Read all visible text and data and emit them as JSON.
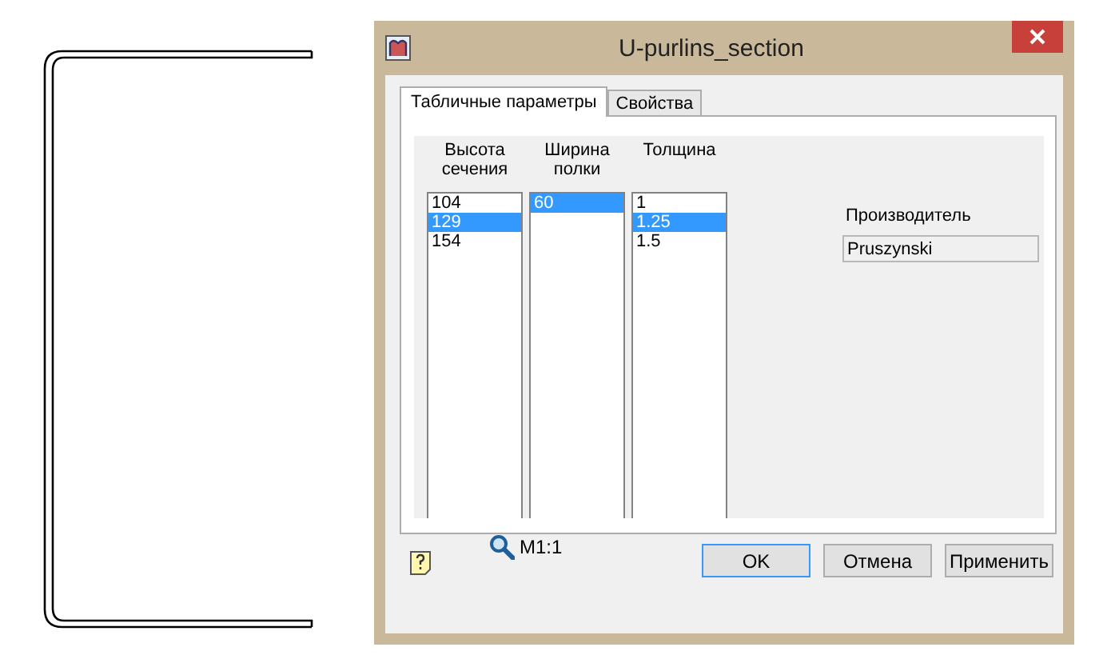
{
  "window": {
    "title": "U-purlins_section"
  },
  "tabs": [
    {
      "label": "Табличные параметры",
      "selected": true
    },
    {
      "label": "Свойства",
      "selected": false
    }
  ],
  "lists": [
    {
      "header": "Высота сечения",
      "items": [
        {
          "label": "104",
          "selected": false
        },
        {
          "label": "129",
          "selected": true
        },
        {
          "label": "154",
          "selected": false
        }
      ]
    },
    {
      "header": "Ширина полки",
      "items": [
        {
          "label": "60",
          "selected": true
        }
      ]
    },
    {
      "header": "Толщина",
      "items": [
        {
          "label": "1",
          "selected": false
        },
        {
          "label": "1.25",
          "selected": true
        },
        {
          "label": "1.5",
          "selected": false
        }
      ]
    }
  ],
  "producer": {
    "label": "Производитель",
    "value": "Pruszynski"
  },
  "scale": "M1:1",
  "buttons": [
    {
      "label": "OK",
      "default": true
    },
    {
      "label": "Отмена",
      "default": false
    },
    {
      "label": "Применить",
      "default": false
    }
  ]
}
